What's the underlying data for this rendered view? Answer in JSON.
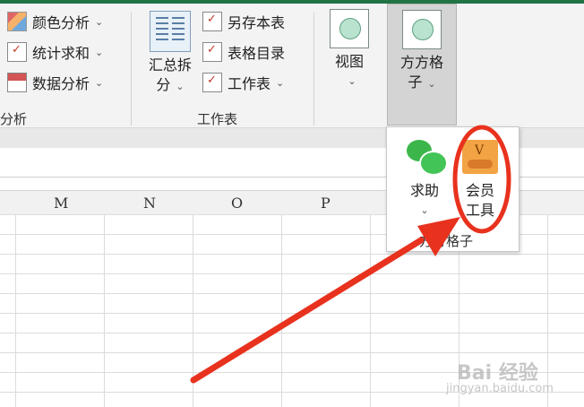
{
  "ribbon": {
    "analysis_items": [
      {
        "label": "颜色分析",
        "icon": "color-analysis-icon"
      },
      {
        "label": "统计求和",
        "icon": "stats-sum-icon"
      },
      {
        "label": "数据分析",
        "icon": "data-analysis-icon"
      }
    ],
    "analysis_group_label": "分析",
    "summarize_split": {
      "line1": "汇总拆",
      "line2": "分"
    },
    "sheet_items": [
      {
        "label": "另存本表"
      },
      {
        "label": "表格目录"
      },
      {
        "label": "工作表"
      }
    ],
    "sheet_group_label": "工作表",
    "view_label": "视图",
    "ffgz": {
      "line1": "方方格",
      "line2": "子"
    }
  },
  "columns": [
    "M",
    "N",
    "O",
    "P"
  ],
  "panel": {
    "help_label": "求助",
    "member_line1": "会员",
    "member_line2": "工具",
    "group_label": "方方格子"
  },
  "watermark": {
    "main": "Bai 经验",
    "sub": "jingyan.baidu.com"
  },
  "colors": {
    "accent": "#217346",
    "annotation": "#e8321e"
  }
}
